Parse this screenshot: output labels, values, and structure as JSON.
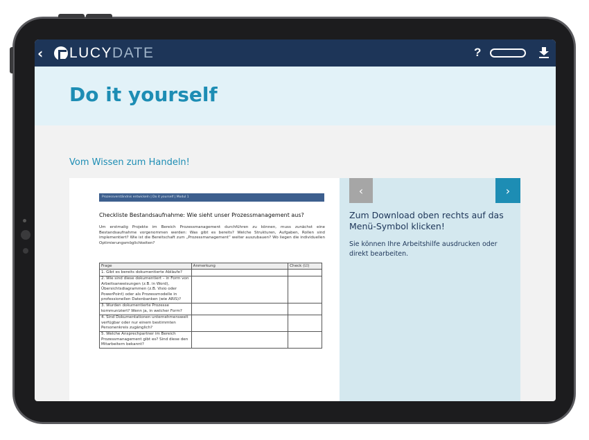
{
  "app": {
    "back_glyph": "‹",
    "logo_part1": "LUCY",
    "logo_part2": "DATE",
    "help_label": "?",
    "accent": "#1d8db4",
    "navy": "#1d3558"
  },
  "hero": {
    "title": "Do it yourself"
  },
  "section": {
    "subtitle": "Vom Wissen zum Handeln!"
  },
  "document": {
    "breadcrumb": "Prozessverständnis entwickeln  |  Do it yourself  |  Modul 1",
    "title": "Checkliste Bestandsaufnahme: Wie sieht unser Prozessmanagement aus?",
    "intro": "Um erstmalig Projekte im Bereich Prozessmanagement durchführen zu können, muss zunächst eine Bestandsaufnahme vorgenommen werden: Was gibt es bereits? Welche Strukturen, Aufgaben, Rollen sind implementiert? Wie ist die Bereitschaft zum „Prozessmanagement“ weiter auszubauen? Wo liegen die individuellen Optimierungsmöglichkeiten?",
    "columns": [
      "Frage",
      "Anmerkung",
      "Check (☑)"
    ],
    "rows": [
      "1. Gibt es bereits dokumentierte Abläufe?",
      "2. Wie sind diese dokumentiert – in Form von Arbeitsanweisungen (z.B. in Word), Übersichtsdiagrammen (z.B. Visio oder PowerPoint) oder als Prozessmodelle in professionellen Datenbanken (wie ARIS)?",
      "3. Wurden dokumentierte Prozesse kommuniziert? Wenn ja, in welcher Form?",
      "4. Sind Dokumentationen unternehmensweit verfügbar oder nur einem bestimmten Personenkreis zugänglich?",
      "5. Welche Ansprechpartner im Bereich Prozessmanagement gibt es? Sind diese den Mitarbeitern bekannt?"
    ]
  },
  "panel": {
    "prev_glyph": "‹",
    "next_glyph": "›",
    "heading": "Zum Download oben rechts auf das Menü-Symbol klicken!",
    "text": "Sie können Ihre Arbeitshilfe ausdrucken oder direkt bearbeiten."
  }
}
